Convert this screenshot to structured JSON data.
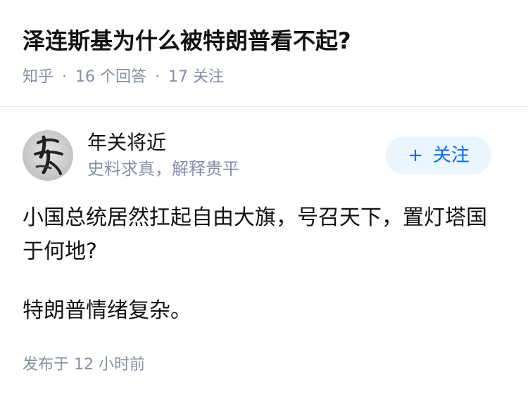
{
  "question": {
    "title": "泽连斯基为什么被特朗普看不起?",
    "source": "知乎",
    "separator": "·",
    "answers_count": "16 个回答",
    "followers_count": "17 关注"
  },
  "author": {
    "name": "年关将近",
    "bio": "史料求真，解释贵平",
    "avatar_icon": "calligraphy-avatar-icon"
  },
  "follow_button": {
    "plus": "+",
    "label": "关注"
  },
  "answer": {
    "paragraphs": [
      "小国总统居然扛起自由大旗，号召天下，置灯塔国于何地?",
      "特朗普情绪复杂。"
    ],
    "published": "发布于 12 小时前"
  },
  "colors": {
    "meta_gray": "#8590a6",
    "accent_blue": "#056de8",
    "follow_bg": "#ebf5fd"
  }
}
